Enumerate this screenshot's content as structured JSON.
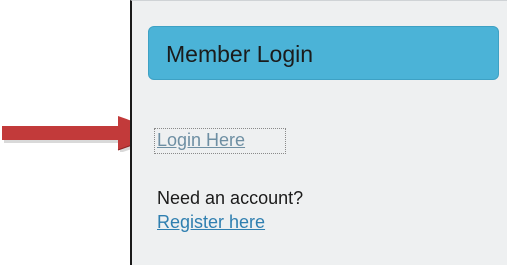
{
  "panel": {
    "title": "Member Login",
    "login_link": "Login Here",
    "need_account": "Need an account?",
    "register_link": "Register here"
  },
  "colors": {
    "header_bg": "#4bb3d7",
    "panel_bg": "#eef0f1",
    "arrow": "#c23a3a",
    "link": "#2f7fb0"
  },
  "annotation": {
    "icon": "red-arrow-icon"
  }
}
